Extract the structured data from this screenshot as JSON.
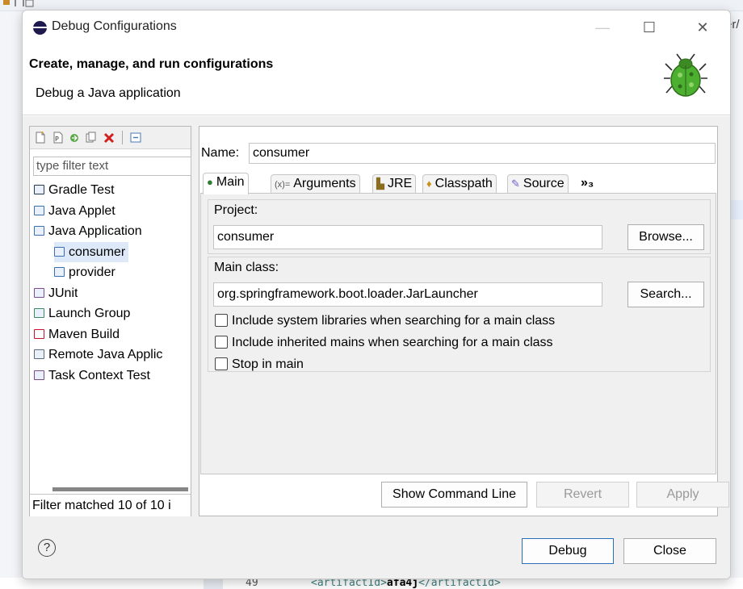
{
  "background": {
    "top_right_fragment": "er/",
    "editor_line_number": "49",
    "editor_code_open": "<artifactId>",
    "editor_code_value": "afa4j",
    "editor_code_close": "</artifactId>"
  },
  "window": {
    "title": "Debug Configurations",
    "minimize_glyph": "—",
    "maximize_glyph": "☐",
    "close_glyph": "✕"
  },
  "header": {
    "title": "Create, manage, and run configurations",
    "subtitle": "Debug a Java application"
  },
  "left_panel": {
    "filter_placeholder": "type filter text",
    "tree": [
      {
        "label": "Gradle Test",
        "indent": 0,
        "icon": "gradle-icon",
        "selected": false
      },
      {
        "label": "Java Applet",
        "indent": 0,
        "icon": "applet-icon",
        "selected": false
      },
      {
        "label": "Java Application",
        "indent": 0,
        "icon": "java-app-icon",
        "selected": false
      },
      {
        "label": "consumer",
        "indent": 1,
        "icon": "java-config-icon",
        "selected": true
      },
      {
        "label": "provider",
        "indent": 1,
        "icon": "java-config-icon",
        "selected": false
      },
      {
        "label": "JUnit",
        "indent": 0,
        "icon": "junit-icon",
        "selected": false
      },
      {
        "label": "Launch Group",
        "indent": 0,
        "icon": "launch-group-icon",
        "selected": false
      },
      {
        "label": "Maven Build",
        "indent": 0,
        "icon": "maven-icon",
        "selected": false
      },
      {
        "label": "Remote Java Applic",
        "indent": 0,
        "icon": "remote-java-icon",
        "selected": false
      },
      {
        "label": "Task Context Test",
        "indent": 0,
        "icon": "task-context-icon",
        "selected": false
      }
    ],
    "status": "Filter matched 10 of 10 i"
  },
  "right_panel": {
    "name_label": "Name:",
    "name_value": "consumer",
    "tabs": [
      {
        "label": "Main",
        "icon": "main-tab-icon",
        "active": true
      },
      {
        "label": "Arguments",
        "icon": "arguments-icon",
        "active": false
      },
      {
        "label": "JRE",
        "icon": "jre-icon",
        "active": false
      },
      {
        "label": "Classpath",
        "icon": "classpath-icon",
        "active": false
      },
      {
        "label": "Source",
        "icon": "source-icon",
        "active": false
      }
    ],
    "more_tabs": "»₃",
    "project_label": "Project:",
    "project_value": "consumer",
    "browse_button": "Browse...",
    "main_class_label": "Main class:",
    "main_class_value": "org.springframework.boot.loader.JarLauncher",
    "search_button": "Search...",
    "checkboxes": [
      {
        "label": "Include system libraries when searching for a main class",
        "checked": false
      },
      {
        "label": "Include inherited mains when searching for a main class",
        "checked": false
      },
      {
        "label": "Stop in main",
        "checked": false
      }
    ],
    "show_command_line_button": "Show Command Line",
    "revert_button": "Revert",
    "apply_button": "Apply"
  },
  "footer": {
    "help_glyph": "?",
    "debug_button": "Debug",
    "close_button": "Close"
  },
  "colors": {
    "selection": "#dde9f8",
    "primary_border": "#2f6fb5",
    "bug_green": "#4caf2f"
  }
}
